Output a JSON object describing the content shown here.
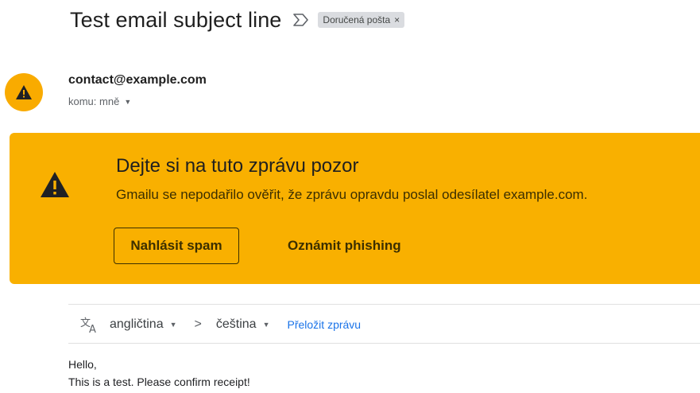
{
  "email": {
    "subject": "Test email subject line",
    "importance_icon": "importance-marker-icon",
    "label_chip": {
      "text": "Doručená pošta",
      "close": "×"
    },
    "sender": {
      "avatar_icon": "warning-triangle-icon",
      "email": "contact@example.com",
      "recipient_label": "komu: mně"
    }
  },
  "warning_banner": {
    "color": "#f9b000",
    "icon": "warning-triangle-icon",
    "title": "Dejte si na tuto zprávu pozor",
    "text": "Gmailu se nepodařilo ověřit, že zprávu opravdu poslal odesílatel example.com.",
    "buttons": {
      "report_spam": "Nahlásit spam",
      "report_phishing": "Oznámit phishing"
    }
  },
  "translate_bar": {
    "icon": "translate-icon",
    "source_language": "angličtina",
    "arrow": ">",
    "target_language": "čeština",
    "translate_link": "Přeložit zprávu",
    "link_color": "#1a73e8"
  },
  "body": {
    "lines": [
      "Hello,",
      "This is a test. Please confirm receipt!"
    ]
  }
}
